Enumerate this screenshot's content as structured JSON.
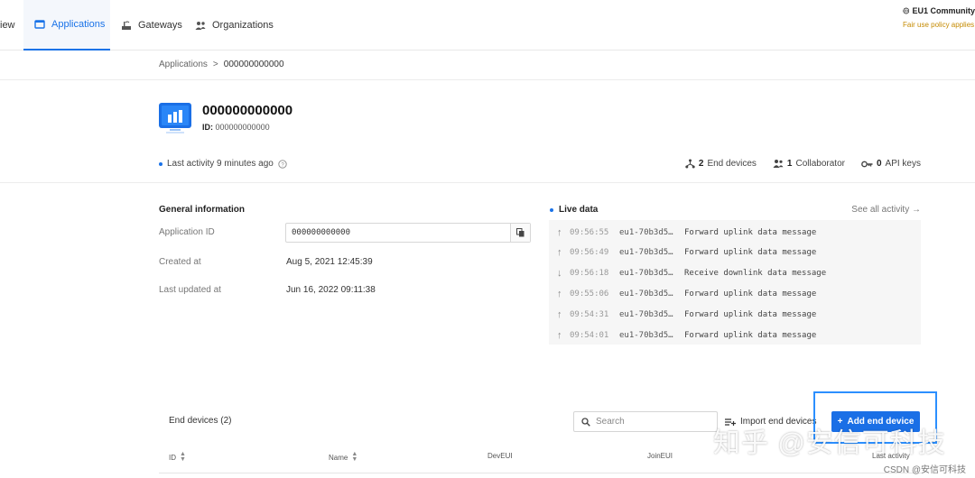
{
  "nav": {
    "overview_partial": "iew",
    "applications": "Applications",
    "gateways": "Gateways",
    "organizations": "Organizations",
    "region": "EU1 Community",
    "fair_use": "Fair use policy applies"
  },
  "breadcrumb": {
    "root": "Applications",
    "separator": ">",
    "current": "000000000000"
  },
  "app": {
    "name": "000000000000",
    "id_label": "ID:",
    "id_value": "000000000000",
    "last_activity": "Last activity 9 minutes ago",
    "end_devices_count": "2",
    "end_devices_label": "End devices",
    "collaborators_count": "1",
    "collaborators_label": "Collaborator",
    "api_keys_count": "0",
    "api_keys_label": "API keys"
  },
  "general": {
    "title": "General information",
    "app_id_label": "Application ID",
    "app_id_value": "000000000000",
    "created_label": "Created at",
    "created_value": "Aug 5, 2021 12:45:39",
    "updated_label": "Last updated at",
    "updated_value": "Jun 16, 2022 09:11:38"
  },
  "live": {
    "title": "Live data",
    "see_all": "See all activity →",
    "events": [
      {
        "dir": "up",
        "time": "09:56:55",
        "device": "eu1-70b3d5…",
        "message": "Forward uplink data message"
      },
      {
        "dir": "up",
        "time": "09:56:49",
        "device": "eu1-70b3d5…",
        "message": "Forward uplink data message"
      },
      {
        "dir": "down",
        "time": "09:56:18",
        "device": "eu1-70b3d5…",
        "message": "Receive downlink data message"
      },
      {
        "dir": "up",
        "time": "09:55:06",
        "device": "eu1-70b3d5…",
        "message": "Forward uplink data message"
      },
      {
        "dir": "up",
        "time": "09:54:31",
        "device": "eu1-70b3d5…",
        "message": "Forward uplink data message"
      },
      {
        "dir": "up",
        "time": "09:54:01",
        "device": "eu1-70b3d5…",
        "message": "Forward uplink data message"
      }
    ]
  },
  "end_devices": {
    "title": "End devices (2)",
    "search_placeholder": "Search",
    "import_label": "Import end devices",
    "add_label": "Add end device",
    "columns": {
      "id": "ID",
      "name": "Name",
      "dev_eui": "DevEUI",
      "join_eui": "JoinEUI",
      "last_activity": "Last activity"
    }
  },
  "watermark": {
    "zhihu": "知乎 @安信可科技",
    "csdn": "CSDN @安信可科技"
  },
  "colors": {
    "accent": "#1a6fe6",
    "fair_use": "#c58a00",
    "highlight": "#2b8fff"
  }
}
